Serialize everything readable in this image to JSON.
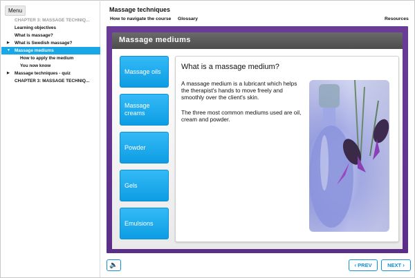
{
  "sidebar": {
    "menu_label": "Menu",
    "items": [
      {
        "arrow": "",
        "label": "CHAPTER 3: MASSAGE TECHNIQ...",
        "level": 0,
        "state": "disabled"
      },
      {
        "arrow": "",
        "label": "Learning objectives",
        "level": 0,
        "state": "normal"
      },
      {
        "arrow": "",
        "label": "What is massage?",
        "level": 0,
        "state": "normal"
      },
      {
        "arrow": "▶",
        "label": "What is Swedish massage?",
        "level": 0,
        "state": "normal"
      },
      {
        "arrow": "▼",
        "label": "Massage mediums",
        "level": 0,
        "state": "active"
      },
      {
        "arrow": "",
        "label": "How to apply the medium",
        "level": 1,
        "state": "normal"
      },
      {
        "arrow": "",
        "label": "You now know",
        "level": 1,
        "state": "normal"
      },
      {
        "arrow": "▶",
        "label": "Massage techniques - quiz",
        "level": 0,
        "state": "normal"
      },
      {
        "arrow": "",
        "label": "CHAPTER 3: MASSAGE TECHNIQ...",
        "level": 0,
        "state": "normal"
      }
    ]
  },
  "header": {
    "course_title": "Massage techniques",
    "link_navigate": "How to navigate the course",
    "link_glossary": "Glossary",
    "link_resources": "Resources"
  },
  "slide": {
    "title": "Massage mediums",
    "buttons": [
      "Massage oils",
      "Massage creams",
      "Powder",
      "Gels",
      "Emulsions"
    ],
    "question": "What is a massage medium?",
    "para1": "A massage medium is a lubricant which helps the therapist's hands to move freely and smoothly over the client's skin.",
    "para2": "The three most common mediums used are oil, cream and powder."
  },
  "footer": {
    "prev_label": "PREV",
    "next_label": "NEXT"
  },
  "icons": {
    "audio": "speaker-icon",
    "prev": "chevron-left-icon",
    "next": "chevron-right-icon"
  },
  "colors": {
    "accent": "#1aa7e8",
    "stage_purple": "#5f338d",
    "button_blue": "#1ba9ee"
  }
}
